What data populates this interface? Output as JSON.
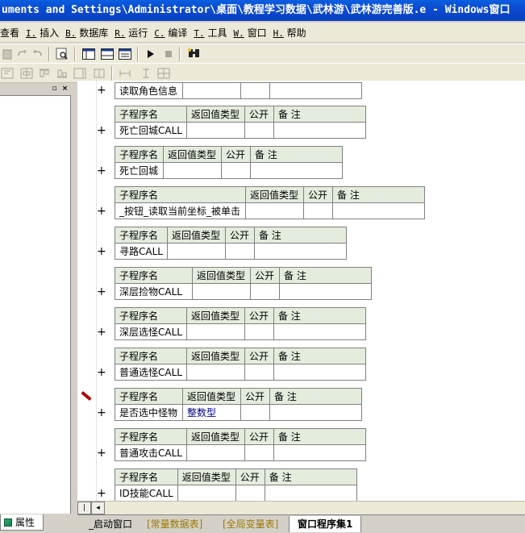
{
  "window": {
    "title": "uments and Settings\\Administrator\\桌面\\教程学习数据\\武林游\\武林游完善版.e - Windows窗口"
  },
  "menubar": {
    "items": [
      {
        "key": "",
        "label": "查看"
      },
      {
        "key": "I.",
        "label": "插入"
      },
      {
        "key": "B.",
        "label": "数据库"
      },
      {
        "key": "R.",
        "label": "运行"
      },
      {
        "key": "C.",
        "label": "编译"
      },
      {
        "key": "T.",
        "label": "工具"
      },
      {
        "key": "W.",
        "label": "窗口"
      },
      {
        "key": "H.",
        "label": "帮助"
      }
    ]
  },
  "left_panel": {
    "properties_tab": "属性"
  },
  "table_header": {
    "name": "子程序名",
    "return_type": "返回值类型",
    "public": "公开",
    "remark": "备 注"
  },
  "subroutines": [
    {
      "name": "读取角色信息",
      "return_type": ""
    },
    {
      "name": "死亡回城CALL",
      "return_type": ""
    },
    {
      "name": "死亡回城",
      "return_type": ""
    },
    {
      "name": "_按钮_读取当前坐标_被单击",
      "return_type": ""
    },
    {
      "name": "寻路CALL",
      "return_type": ""
    },
    {
      "name": "深层捡物CALL",
      "return_type": ""
    },
    {
      "name": "深层选怪CALL",
      "return_type": ""
    },
    {
      "name": "普通选怪CALL",
      "return_type": ""
    },
    {
      "name": "是否选中怪物",
      "return_type": "整数型"
    },
    {
      "name": "普通攻击CALL",
      "return_type": ""
    },
    {
      "name": "ID技能CALL",
      "return_type": ""
    }
  ],
  "bottom_tabs": {
    "startup_window": "_启动窗口",
    "constants": "[常量数据表]",
    "globals": "[全局变量表]",
    "window_procs": "窗口程序集1"
  },
  "colors": {
    "title_bar": "#0b4bd1",
    "table_header_bg": "#e4ecde",
    "tab_gold": "#9c7a00",
    "return_type_blue": "#00008b"
  }
}
